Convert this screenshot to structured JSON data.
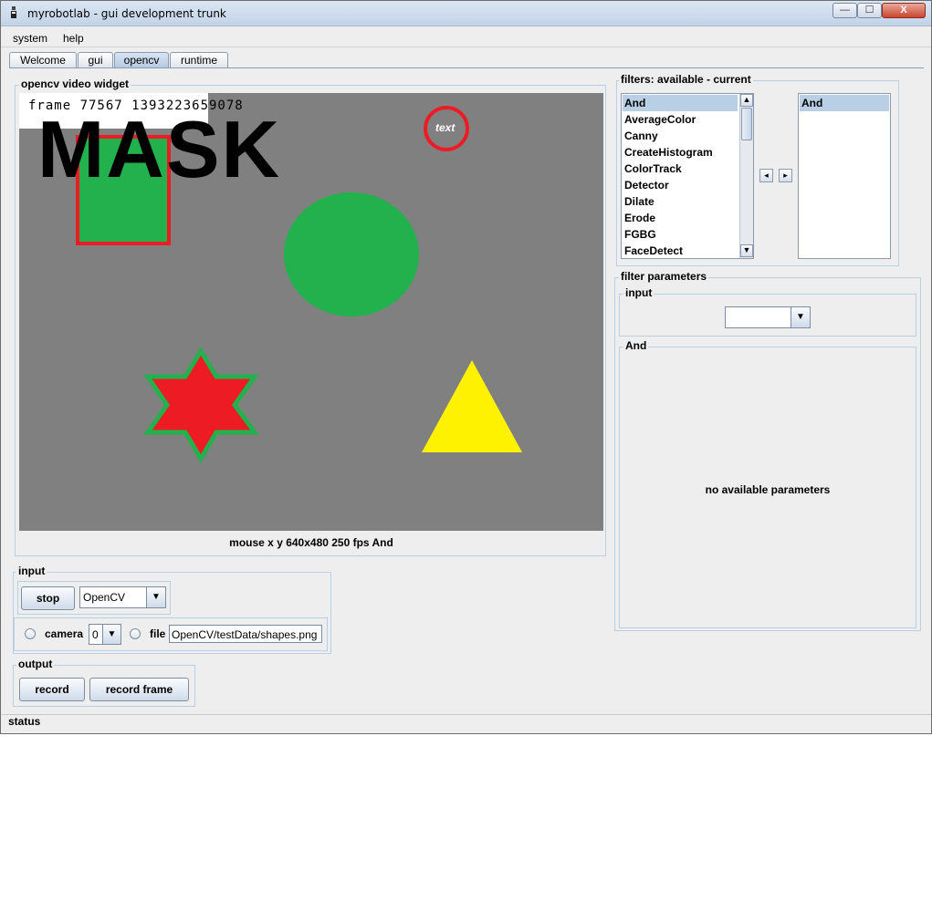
{
  "window": {
    "title": "myrobotlab - gui development trunk",
    "controls": {
      "minimize": "—",
      "maximize": "☐",
      "close": "X"
    }
  },
  "menu": [
    "system",
    "help"
  ],
  "tabs": [
    {
      "label": "Welcome",
      "active": false
    },
    {
      "label": "gui",
      "active": false
    },
    {
      "label": "opencv",
      "active": true
    },
    {
      "label": "runtime",
      "active": false
    }
  ],
  "video_widget": {
    "title": "opencv  video widget",
    "frame_text": "frame 77567 1393223659078",
    "overlay_text": "MASK",
    "circle_label": "text",
    "status": "mouse x y  640x480  250 fps  And",
    "colors": {
      "background": "#808080",
      "green": "#22b14c",
      "red": "#ed1c24",
      "yellow": "#fff200"
    }
  },
  "input": {
    "title": "input",
    "stop_label": "stop",
    "grabber_value": "OpenCV",
    "camera_label": "camera",
    "camera_index": "0",
    "file_label": "file",
    "file_value": "OpenCV/testData/shapes.png"
  },
  "output": {
    "title": "output",
    "record_label": "record",
    "record_frame_label": "record frame"
  },
  "filters": {
    "title": "filters: available - current",
    "available": [
      "And",
      "AverageColor",
      "Canny",
      "CreateHistogram",
      "ColorTrack",
      "Detector",
      "Dilate",
      "Erode",
      "FGBG",
      "FaceDetect"
    ],
    "current": [
      "And"
    ],
    "add_arrow": "◂",
    "remove_arrow": "▸"
  },
  "filter_parameters": {
    "title": "filter parameters",
    "input_title": "input",
    "input_value": "",
    "section_title": "And",
    "message": "no available parameters"
  },
  "status": {
    "label": "status"
  }
}
